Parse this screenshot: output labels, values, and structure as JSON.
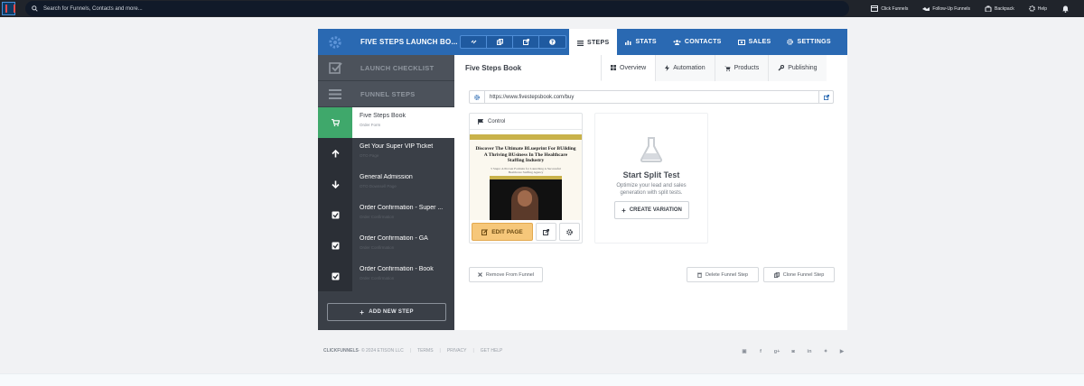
{
  "topbar": {
    "search_placeholder": "Search for Funnels, Contacts and more...",
    "links": [
      "Click Funnels",
      "Follow-Up Funnels",
      "Backpack",
      "Help"
    ]
  },
  "header": {
    "funnel_title": "FIVE STEPS LAUNCH BO...",
    "tabs": [
      "STEPS",
      "STATS",
      "CONTACTS",
      "SALES",
      "SETTINGS"
    ],
    "active_tab": "STEPS"
  },
  "sidebar": {
    "sections": [
      "LAUNCH CHECKLIST",
      "FUNNEL STEPS"
    ],
    "steps": [
      {
        "name": "Five Steps Book",
        "sub": "Order Form"
      },
      {
        "name": "Get Your Super VIP Ticket",
        "sub": "OTO Page"
      },
      {
        "name": "General Admission",
        "sub": "OTO Downsell Page"
      },
      {
        "name": "Order Confirmation - Super ...",
        "sub": "Order Confirmation"
      },
      {
        "name": "Order Confirmation - GA",
        "sub": "Order Confirmation"
      },
      {
        "name": "Order Confirmation - Book",
        "sub": "Order Confirmation"
      }
    ],
    "add_step_label": "ADD NEW STEP"
  },
  "main": {
    "step_title": "Five Steps Book",
    "sub_tabs": [
      "Overview",
      "Automation",
      "Products",
      "Publishing"
    ],
    "url": "https://www.fivestepsbook.com/buy",
    "control": {
      "label": "Control",
      "preview_heading": "Discover The Ultimate BLueprint For BUilding A Thriving BUsiness In The Healthcare Staffing Industry",
      "preview_sub": "5 Steps: A Proven Formula for Launching A Successful Healthcare Staffing Agency",
      "edit_label": "EDIT PAGE"
    },
    "split": {
      "title": "Start Split Test",
      "desc": "Optimize your lead and sales generation with split tests.",
      "button": "CREATE VARIATION"
    },
    "actions": {
      "remove": "Remove From Funnel",
      "delete": "Delete Funnel Step",
      "clone": "Clone Funnel Step"
    }
  },
  "footer": {
    "brand": "CLICKFUNNELS",
    "copyright": " - © 2024 ETISON LLC",
    "links": [
      "TERMS",
      "PRIVACY",
      "GET HELP"
    ]
  },
  "colors": {
    "header_blue": "#2a69b2",
    "active_step_green": "#3fa86b",
    "edit_button": "#f6c77a",
    "sidebar_dark": "#3a3f47"
  }
}
